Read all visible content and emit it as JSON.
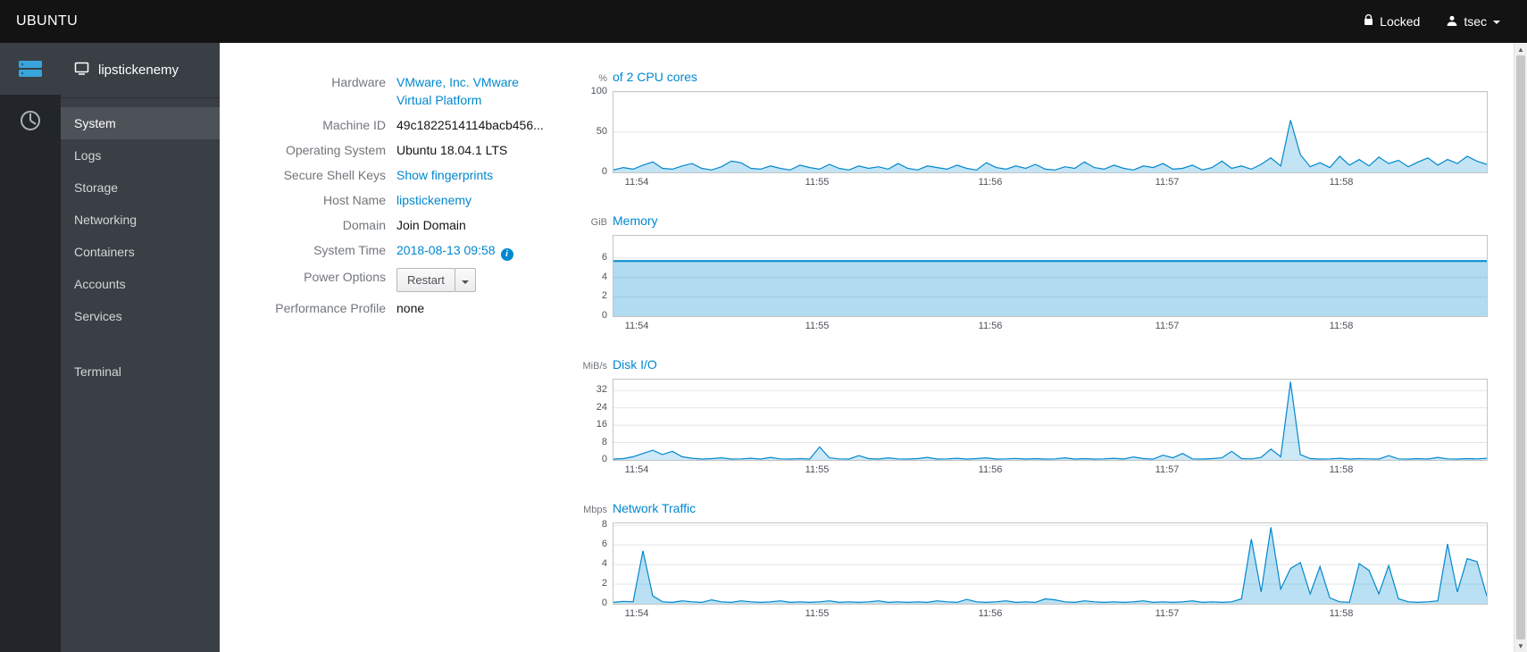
{
  "topbar": {
    "brand": "UBUNTU",
    "locked_label": "Locked",
    "user_label": "tsec"
  },
  "sidebar": {
    "host_name": "lipstickenemy",
    "items": [
      {
        "label": "System",
        "active": true
      },
      {
        "label": "Logs"
      },
      {
        "label": "Storage"
      },
      {
        "label": "Networking"
      },
      {
        "label": "Containers"
      },
      {
        "label": "Accounts"
      },
      {
        "label": "Services"
      },
      {
        "label": "Terminal",
        "gap_before": true
      }
    ]
  },
  "system_info": {
    "rows": [
      {
        "label": "Hardware",
        "value": "VMware, Inc. VMware Virtual Platform",
        "type": "link",
        "name": "hardware-link"
      },
      {
        "label": "Machine ID",
        "value": "49c1822514114bacb456...",
        "type": "text",
        "name": "machine-id-value"
      },
      {
        "label": "Operating System",
        "value": "Ubuntu 18.04.1 LTS",
        "type": "text",
        "name": "operating-system-value"
      },
      {
        "label": "Secure Shell Keys",
        "value": "Show fingerprints",
        "type": "link",
        "name": "show-fingerprints-link"
      },
      {
        "label": "Host Name",
        "value": "lipstickenemy",
        "type": "link",
        "name": "host-name-link"
      },
      {
        "label": "Domain",
        "value": "Join Domain",
        "type": "action",
        "name": "join-domain-link"
      },
      {
        "label": "System Time",
        "value": "2018-08-13 09:58",
        "type": "link",
        "info_icon": true,
        "name": "system-time-link"
      },
      {
        "label": "Power Options",
        "value": "Restart",
        "type": "button",
        "name": "restart-button"
      },
      {
        "label": "Performance Profile",
        "value": "none",
        "type": "text",
        "name": "performance-profile-value"
      }
    ]
  },
  "charts": {
    "x_ticks": [
      {
        "label": "11:54",
        "t": 0.028
      },
      {
        "label": "11:55",
        "t": 0.234
      },
      {
        "label": "11:56",
        "t": 0.433
      },
      {
        "label": "11:57",
        "t": 0.635
      },
      {
        "label": "11:58",
        "t": 0.834
      }
    ]
  },
  "chart_data": [
    {
      "type": "area",
      "unit": "%",
      "title": "of 2 CPU cores",
      "ylabel": "% of 2 CPU cores",
      "xlabels": [
        "11:54",
        "11:55",
        "11:56",
        "11:57",
        "11:58"
      ],
      "ylim": [
        0,
        100
      ],
      "yticks": [
        0,
        50,
        100
      ],
      "stroke": "#0088ce",
      "fill": "rgba(57,165,220,0.30)",
      "line_width": 1.2,
      "values": [
        3,
        6,
        4,
        9,
        13,
        5,
        4,
        8,
        11,
        5,
        3,
        7,
        14,
        12,
        5,
        4,
        8,
        5,
        3,
        9,
        6,
        4,
        10,
        5,
        3,
        8,
        5,
        7,
        4,
        11,
        5,
        3,
        8,
        6,
        4,
        9,
        5,
        3,
        12,
        6,
        4,
        8,
        5,
        10,
        4,
        3,
        7,
        5,
        13,
        6,
        4,
        9,
        5,
        3,
        8,
        6,
        11,
        4,
        5,
        9,
        3,
        6,
        14,
        5,
        8,
        4,
        10,
        18,
        8,
        65,
        22,
        7,
        12,
        6,
        20,
        9,
        16,
        8,
        19,
        11,
        15,
        7,
        13,
        18,
        9,
        16,
        11,
        20,
        14,
        10
      ]
    },
    {
      "type": "area",
      "unit": "GiB",
      "title": "Memory",
      "ylabel": "GiB Memory",
      "xlabels": [
        "11:54",
        "11:55",
        "11:56",
        "11:57",
        "11:58"
      ],
      "ylim": [
        0,
        8.3
      ],
      "yticks": [
        0,
        2,
        4,
        6
      ],
      "stroke": "#0088ce",
      "fill": "rgba(57,165,220,0.40)",
      "line_width": 2,
      "values": [
        5.7,
        5.7,
        5.7,
        5.7,
        5.7,
        5.7,
        5.7,
        5.7,
        5.7,
        5.7,
        5.7,
        5.7,
        5.7,
        5.7,
        5.7,
        5.7,
        5.7,
        5.7,
        5.7,
        5.7,
        5.7,
        5.7,
        5.7,
        5.7
      ]
    },
    {
      "type": "line",
      "unit": "MiB/s",
      "title": "Disk I/O",
      "ylabel": "MiB/s Disk I/O",
      "xlabels": [
        "11:54",
        "11:55",
        "11:56",
        "11:57",
        "11:58"
      ],
      "ylim": [
        0,
        37
      ],
      "yticks": [
        0,
        8,
        16,
        24,
        32
      ],
      "stroke": "#0088ce",
      "fill": "rgba(57,165,220,0.25)",
      "line_width": 1.2,
      "values": [
        0.4,
        0.6,
        1.5,
        3,
        4.5,
        2.5,
        4,
        1.5,
        0.8,
        0.4,
        0.6,
        1,
        0.4,
        0.5,
        0.8,
        0.4,
        1.2,
        0.5,
        0.4,
        0.6,
        0.4,
        6,
        1,
        0.5,
        0.4,
        2,
        0.6,
        0.4,
        1,
        0.5,
        0.4,
        0.6,
        1.2,
        0.4,
        0.5,
        0.8,
        0.4,
        0.6,
        1,
        0.4,
        0.5,
        0.7,
        0.4,
        0.6,
        0.4,
        0.5,
        1,
        0.4,
        0.6,
        0.4,
        0.5,
        0.8,
        0.4,
        1.4,
        0.6,
        0.4,
        2.2,
        1,
        3,
        0.5,
        0.4,
        0.6,
        1,
        4,
        0.6,
        0.5,
        1.2,
        5,
        1.5,
        36,
        2.5,
        0.6,
        0.4,
        0.5,
        0.8,
        0.4,
        0.6,
        0.5,
        0.4,
        2,
        0.5,
        0.4,
        0.6,
        0.4,
        1.2,
        0.5,
        0.4,
        0.6,
        0.5,
        0.8
      ]
    },
    {
      "type": "area",
      "unit": "Mbps",
      "title": "Network Traffic",
      "ylabel": "Mbps Network Traffic",
      "xlabels": [
        "11:54",
        "11:55",
        "11:56",
        "11:57",
        "11:58"
      ],
      "ylim": [
        0,
        8.2
      ],
      "yticks": [
        0,
        2,
        4,
        6,
        8
      ],
      "stroke": "#0088ce",
      "fill": "rgba(57,165,220,0.35)",
      "line_width": 1.2,
      "values": [
        0.15,
        0.25,
        0.2,
        5.4,
        0.8,
        0.2,
        0.15,
        0.3,
        0.2,
        0.15,
        0.4,
        0.2,
        0.15,
        0.3,
        0.2,
        0.15,
        0.2,
        0.3,
        0.15,
        0.2,
        0.15,
        0.2,
        0.3,
        0.15,
        0.2,
        0.15,
        0.2,
        0.3,
        0.15,
        0.2,
        0.15,
        0.2,
        0.15,
        0.3,
        0.2,
        0.15,
        0.45,
        0.2,
        0.15,
        0.2,
        0.3,
        0.15,
        0.2,
        0.15,
        0.5,
        0.4,
        0.2,
        0.15,
        0.3,
        0.2,
        0.15,
        0.2,
        0.15,
        0.2,
        0.3,
        0.15,
        0.2,
        0.15,
        0.2,
        0.3,
        0.15,
        0.2,
        0.15,
        0.2,
        0.5,
        6.6,
        1.2,
        7.8,
        1.5,
        3.6,
        4.2,
        1,
        3.8,
        0.6,
        0.2,
        0.15,
        4.1,
        3.4,
        1,
        3.9,
        0.5,
        0.2,
        0.15,
        0.2,
        0.3,
        6.1,
        1.2,
        4.6,
        4.3,
        0.8
      ]
    }
  ],
  "colors": {
    "accent_blue": "#0088ce",
    "icon_blue": "#39a5dc",
    "topbar_bg": "#131313",
    "sidebar_bg": "#393f44"
  }
}
